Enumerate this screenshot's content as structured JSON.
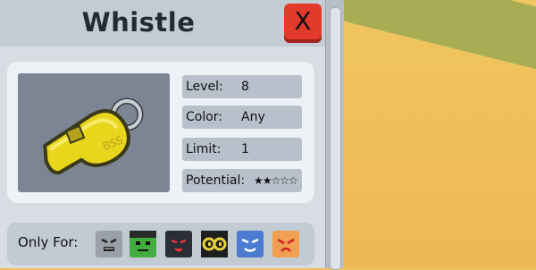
{
  "item": {
    "title": "Whistle",
    "close_label": "X",
    "image_text": "BSS"
  },
  "stats": [
    {
      "label": "Level:",
      "value": "8"
    },
    {
      "label": "Color:",
      "value": "Any"
    },
    {
      "label": "Limit:",
      "value": "1"
    },
    {
      "label": "Potential:",
      "value": "★★☆☆☆"
    }
  ],
  "only_for": {
    "label": "Only For:",
    "bees": [
      {
        "icon": "gray-bee-face-icon",
        "color": "#9aa0a8"
      },
      {
        "icon": "green-bee-face-icon",
        "color": "#3fae3f"
      },
      {
        "icon": "black-bee-face-icon",
        "color": "#2b2e36"
      },
      {
        "icon": "yellow-bee-face-icon",
        "color": "#e8d23a"
      },
      {
        "icon": "blue-bee-face-icon",
        "color": "#4a7bd0"
      },
      {
        "icon": "orange-bee-face-icon",
        "color": "#f0a050"
      }
    ]
  },
  "colors": {
    "close_button": "#e23a2a",
    "panel": "#d7dde3",
    "header": "#c3ccd5"
  }
}
